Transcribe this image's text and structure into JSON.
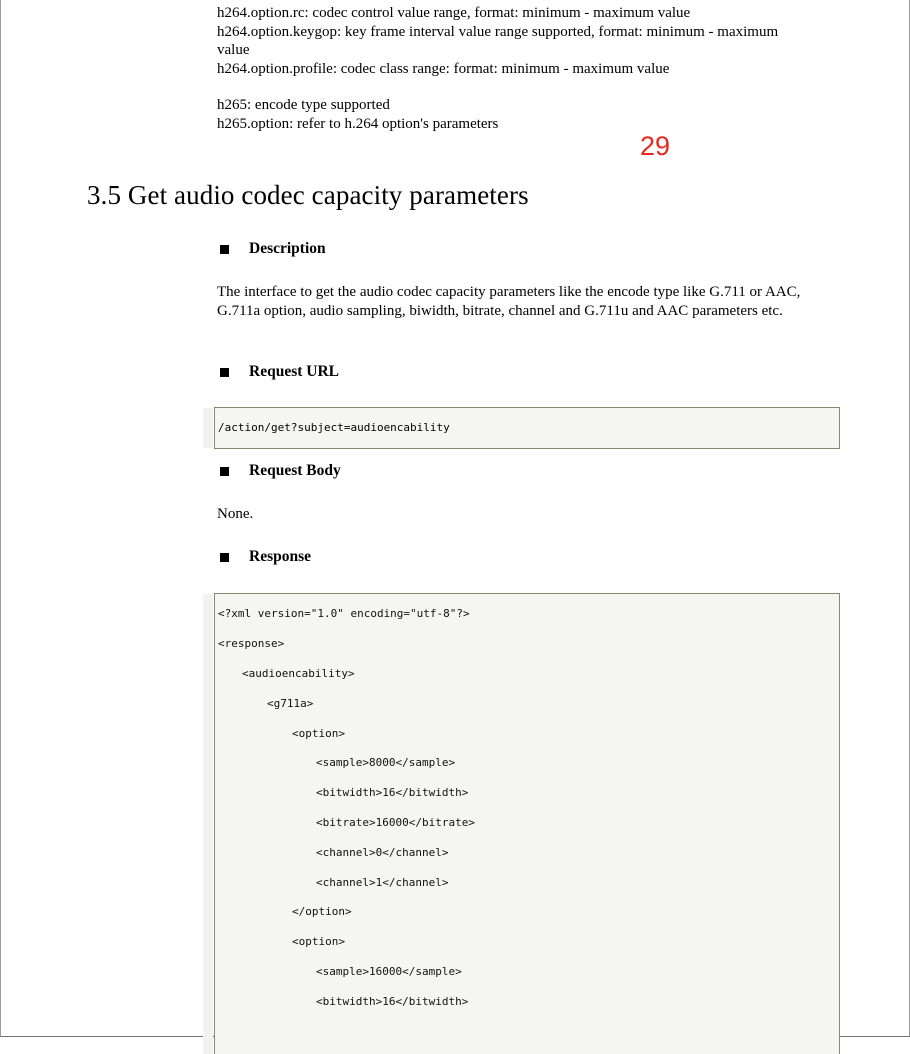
{
  "top_text": {
    "line1": "h264.option.rc: codec control value range, format: minimum - maximum value",
    "line2": "h264.option.keygop: key frame interval value range supported, format: minimum - maximum",
    "line3": "value",
    "line4": "h264.option.profile: codec class range: format: minimum - maximum value",
    "line5": "h265: encode type supported",
    "line6": "h265.option:   refer to h.264 option's parameters"
  },
  "page_number": "29",
  "section": {
    "title": "3.5 Get audio codec capacity parameters"
  },
  "description": {
    "heading": "Description",
    "body": "The interface to get the audio codec capacity parameters like the encode type like G.711 or AAC, G.711a option, audio sampling, biwidth, bitrate, channel and G.711u and AAC parameters etc."
  },
  "request_url": {
    "heading": "Request URL",
    "code": "/action/get?subject=audioencability"
  },
  "request_body": {
    "heading": "Request Body",
    "body": "None."
  },
  "response": {
    "heading": "Response",
    "lines": [
      "<?xml version=\"1.0\" encoding=\"utf-8\"?>",
      "<response>",
      "<audioencability>",
      "<g711a>",
      "<option>",
      "<sample>8000</sample>",
      "<bitwidth>16</bitwidth>",
      "<bitrate>16000</bitrate>",
      "<channel>0</channel>",
      "<channel>1</channel>",
      "</option>",
      "<option>",
      "<sample>16000</sample>",
      "<bitwidth>16</bitwidth>"
    ]
  }
}
